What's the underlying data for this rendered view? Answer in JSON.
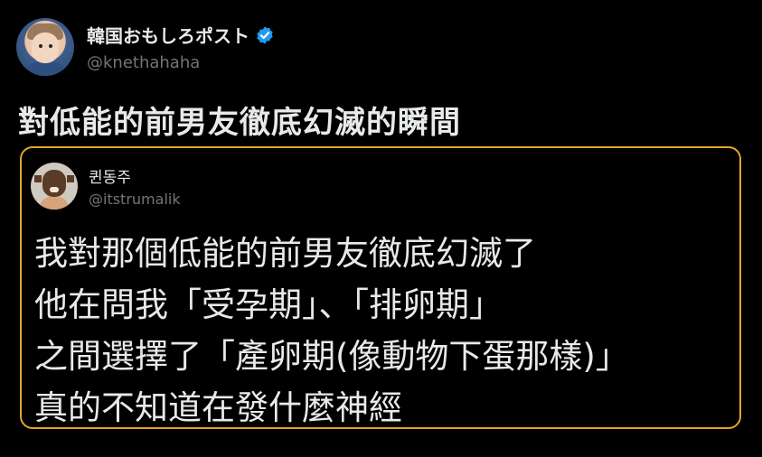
{
  "author": {
    "display_name": "韓国おもしろポスト",
    "handle": "@knethahaha",
    "verified": true
  },
  "tweet": {
    "text": "對低能的前男友徹底幻滅的瞬間"
  },
  "quote": {
    "border_color": "#e3a529",
    "author": {
      "display_name": "퀸동주",
      "handle": "@itstrumalik"
    },
    "lines": [
      "我對那個低能的前男友徹底幻滅了",
      "他在問我「受孕期」、「排卵期」",
      "之間選擇了「產卵期(像動物下蛋那樣)」",
      "真的不知道在發什麼神經"
    ]
  },
  "colors": {
    "background": "#000000",
    "text": "#e7e9ea",
    "muted": "#71767b",
    "verified": "#1d9bf0"
  },
  "icons": {
    "verified": "verified-badge-icon"
  }
}
